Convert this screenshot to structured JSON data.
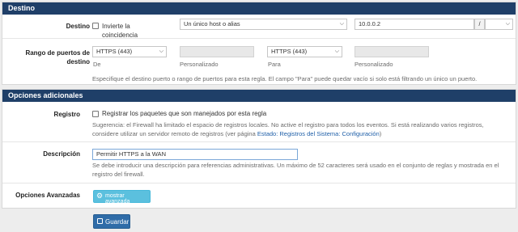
{
  "destino_section": {
    "title": "Destino",
    "destino_label": "Destino",
    "invert_label_line1": "Invierte la",
    "invert_label_line2": "coincidencia",
    "type_select": "Un único host o alias",
    "address_value": "10.0.0.2",
    "slash": "/",
    "port_range_label_line1": "Rango de puertos de",
    "port_range_label_line2": "destino",
    "from_select": "HTTPS (443)",
    "from_caption": "De",
    "from_custom_caption": "Personalizado",
    "to_select": "HTTPS (443)",
    "to_caption": "Para",
    "to_custom_caption": "Personalizado",
    "help_text": "Especifique el destino puerto o rango de puertos para esta regla. El campo \"Para\" puede quedar vacío si solo está filtrando un único un puerto."
  },
  "additional_section": {
    "title": "Opciones adicionales",
    "log_label": "Registro",
    "log_checkbox_text": "Registrar los paquetes que son manejados por esta regla",
    "log_help_line1": "Sugerencia: el Firewall ha limitado el espacio de registros locales. No active el registro para todos los eventos. Si está realizando varios registros,",
    "log_help_line2_prefix": "considere utilizar un servidor remoto de registros (ver página ",
    "log_help_link": "Estado: Registros del Sistema: Configuración",
    "log_help_line2_suffix": ")",
    "description_label": "Descripción",
    "description_value": "Permitir HTTPS a la WAN",
    "description_help_line1": "Se debe introducir una descripción para referencias administrativas. Un máximo de 52 caracteres será usado en el conjunto de reglas y mostrada en el",
    "description_help_line2": "registro del firewall.",
    "advanced_label": "Opciones Avanzadas",
    "advanced_button": "mostrar avanzada"
  },
  "save_button": "Guardar",
  "colors": {
    "header_bg": "#1f3f68",
    "info_button": "#5bc0de",
    "primary_button": "#2f6ca8",
    "link": "#1f5fa8"
  },
  "icons": {
    "select_arrow": "chevron-down-icon",
    "advanced": "gear-icon",
    "save": "save-icon"
  }
}
